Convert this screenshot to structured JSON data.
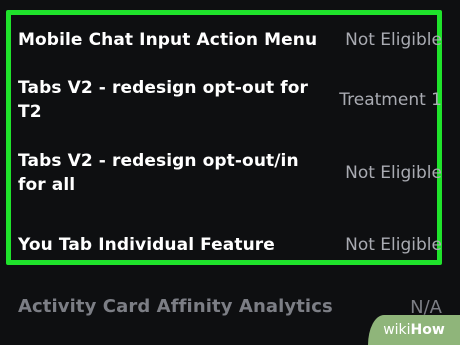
{
  "experiments": [
    {
      "name": "Mobile Chat Input Action Menu",
      "status": "Not Eligible"
    },
    {
      "name": "Tabs V2 - redesign opt-out for T2",
      "status": "Treatment 1"
    },
    {
      "name": "Tabs V2 - redesign opt-out/in for all",
      "status": "Not Eligible"
    },
    {
      "name": "You Tab Individual Feature",
      "status": "Not Eligible"
    },
    {
      "name": "Activity Card Affinity Analytics",
      "status": "N/A"
    }
  ],
  "highlight_color": "#1fe22b",
  "watermark": {
    "part1": "wiki",
    "part2": "How"
  }
}
